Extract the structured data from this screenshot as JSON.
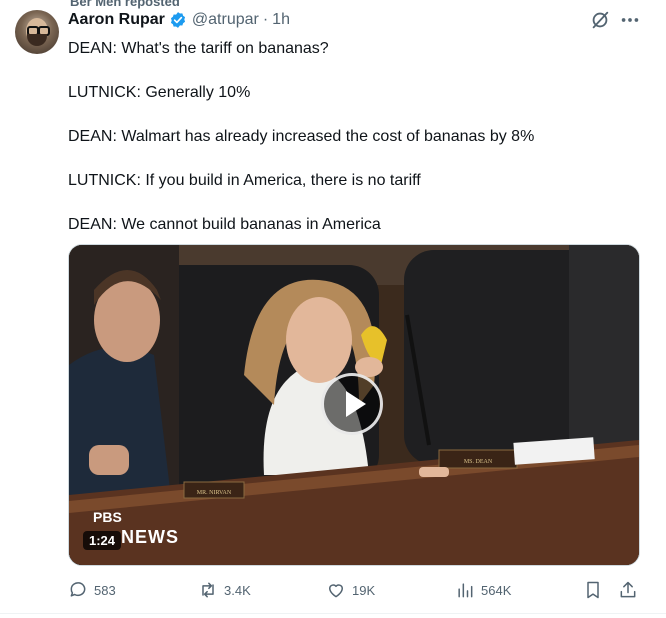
{
  "social_context": "Ber Men reposted",
  "author": {
    "name": "Aaron Rupar",
    "handle": "@atrupar",
    "separator": "·",
    "time": "1h"
  },
  "tweet_lines": [
    "DEAN: What's the tariff on bananas?",
    "LUTNICK: Generally 10%",
    "DEAN: Walmart has already increased the cost of bananas by 8%",
    "LUTNICK: If you build in America, there is no tariff",
    "DEAN: We cannot build bananas in America"
  ],
  "video": {
    "duration": "1:24",
    "watermark_top": "PBS",
    "watermark_bottom": "NEWS",
    "nameplate_left": "MR. NIRVAN",
    "nameplate_right": "MS. DEAN"
  },
  "actions": {
    "replies": "583",
    "reposts": "3.4K",
    "likes": "19K",
    "views": "564K"
  },
  "colors": {
    "verified": "#1d9bf0",
    "icon_gray": "#536471",
    "text": "#0f1419"
  }
}
